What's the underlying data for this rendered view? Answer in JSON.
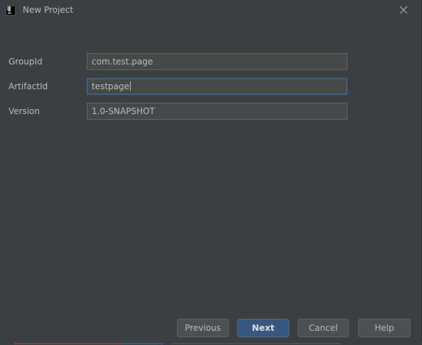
{
  "window": {
    "title": "New Project",
    "icon": "intellij-idea-icon",
    "icon_text": "IJ"
  },
  "form": {
    "group_id": {
      "label": "GroupId",
      "value": "com.test.page"
    },
    "artifact_id": {
      "label": "ArtifactId",
      "value": "testpage"
    },
    "version": {
      "label": "Version",
      "value": "1.0-SNAPSHOT"
    }
  },
  "buttons": {
    "previous": "Previous",
    "next": "Next",
    "cancel": "Cancel",
    "help": "Help"
  },
  "colors": {
    "background": "#3c3f41",
    "field_background": "#45494a",
    "field_border": "#646464",
    "focus_border": "#3d6185",
    "primary_button": "#365880",
    "text": "#bbbbbb"
  }
}
